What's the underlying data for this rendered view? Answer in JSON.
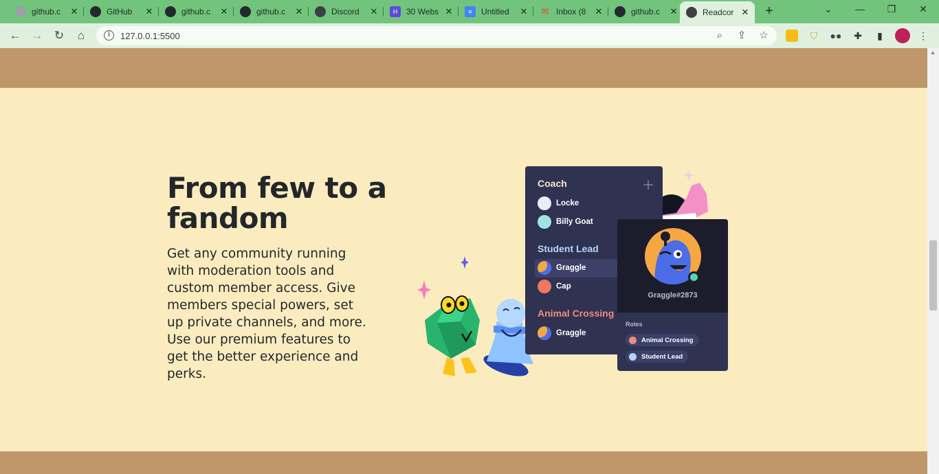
{
  "browser": {
    "tabs": [
      {
        "title": "github.c",
        "favicon": "globe-icon",
        "color": "#9aa0a6"
      },
      {
        "title": "GitHub",
        "favicon": "github-icon",
        "color": "#24292f"
      },
      {
        "title": "github.c",
        "favicon": "github-icon",
        "color": "#24292f"
      },
      {
        "title": "github.c",
        "favicon": "github-icon",
        "color": "#24292f"
      },
      {
        "title": "Discord",
        "favicon": "globe-icon",
        "color": "#3c4043"
      },
      {
        "title": "30 Webs",
        "favicon": "h-logo-icon",
        "color": "#5c4bd8"
      },
      {
        "title": "Untitled",
        "favicon": "docs-icon",
        "color": "#4285f4"
      },
      {
        "title": "Inbox (8",
        "favicon": "mail-icon",
        "color": "#e8453c"
      },
      {
        "title": "github.c",
        "favicon": "github-icon",
        "color": "#24292f"
      },
      {
        "title": "Readcor",
        "favicon": "globe-icon",
        "color": "#3c4043",
        "active": true
      }
    ],
    "url": "127.0.0.1:5500",
    "theme_color": "#72c47c",
    "toolbar_color": "#dff1de"
  },
  "section": {
    "headline": "From few to a fandom",
    "body": "Get any community running with moderation tools and custom member access. Give members special powers, set up private channels, and more. Use our premium features to get the better experience and perks.",
    "background": "#fbecc0",
    "band_color": "#c0976a"
  },
  "illustration": {
    "roles": [
      {
        "name": "Coach",
        "color": "#f6e6c8",
        "members": [
          {
            "name": "Locke",
            "avatar": "#e9eef5"
          },
          {
            "name": "Billy Goat",
            "avatar": "#9fe4e0"
          }
        ]
      },
      {
        "name": "Student Lead",
        "color": "#b9d4ff",
        "members": [
          {
            "name": "Graggle",
            "avatar": "#f5a742",
            "highlighted": true
          },
          {
            "name": "Cap",
            "avatar": "#f0785e"
          }
        ]
      },
      {
        "name": "Animal Crossing",
        "color": "#ef8c7b",
        "members": [
          {
            "name": "Graggle",
            "avatar": "#f5a742"
          }
        ]
      }
    ],
    "profile": {
      "username": "Graggle#2873",
      "roles_label": "Roles",
      "roles": [
        {
          "name": "Animal Crossing",
          "color": "#ef8c7b"
        },
        {
          "name": "Student Lead",
          "color": "#b9d4ff"
        }
      ]
    }
  }
}
